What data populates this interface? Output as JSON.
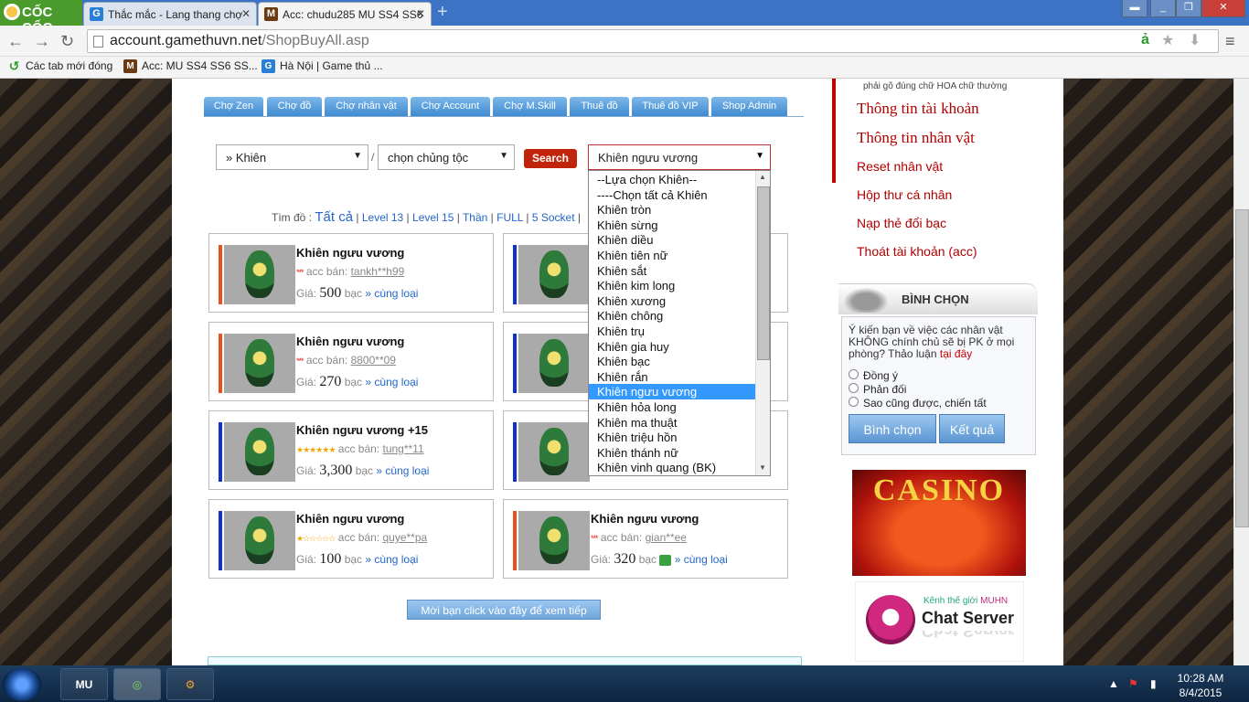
{
  "browser": {
    "brand": "CỐC CỐC",
    "tabs": [
      {
        "title": "Thắc mắc - Lang thang chợ",
        "icon": "G"
      },
      {
        "title": "Acc: chudu285 MU SS4 SS6",
        "icon": "M"
      }
    ],
    "url_host": "account.gamethuvn.net",
    "url_path": "/ShopBuyAll.asp",
    "bookmarks": [
      "Các tab mới đóng",
      "Acc: MU SS4 SS6 SS...",
      "Hà Nội | Game thủ ..."
    ]
  },
  "nav_tabs": [
    "Chợ Zen",
    "Chợ đồ",
    "Chợ nhân vật",
    "Chợ Account",
    "Chợ M.Skill",
    "Thuê đồ",
    "Thuê đồ VIP",
    "Shop Admin"
  ],
  "search": {
    "category": "» Khiên",
    "separator": "/",
    "race": "chọn chủng tộc",
    "button": "Search",
    "item_select": "Khiên ngưu vương"
  },
  "filter": {
    "label": "Tìm đồ :",
    "all": "Tất cả",
    "options": [
      "Level 13",
      "Level 15",
      "Thần",
      "FULL",
      "5 Socket"
    ]
  },
  "dropdown_options": [
    "--Lựa chọn Khiên--",
    "----Chọn tất cả Khiên",
    "Khiên tròn",
    "Khiên sừng",
    "Khiên diều",
    "Khiên tiên nữ",
    "Khiên sắt",
    "Khiên kim long",
    "Khiên xương",
    "Khiên chông",
    "Khiên trụ",
    "Khiên gia huy",
    "Khiên bạc",
    "Khiên rắn",
    "Khiên ngưu vương",
    "Khiên hỏa long",
    "Khiên ma thuật",
    "Khiên triệu hồn",
    "Khiên thánh nữ",
    "Khiên vinh quang (BK)"
  ],
  "dropdown_selected_index": 14,
  "cards": [
    {
      "name": "Khiên ngưu vương",
      "seller_label": "acc bán:",
      "seller": "tankh**h99",
      "price_label": "Giá:",
      "price": "500",
      "unit": "bạc",
      "same": "» cùng loại",
      "rating": "***",
      "bar": "#e8501e"
    },
    {
      "name": "Khiên ngưu vương",
      "seller_label": "acc bán:",
      "seller": "8800**09",
      "price_label": "Giá:",
      "price": "270",
      "unit": "bạc",
      "same": "» cùng loại",
      "rating": "***",
      "bar": "#e8501e"
    },
    {
      "name": "Khiên ngưu vương +15",
      "seller_label": "acc bán:",
      "seller": "tung**11",
      "price_label": "Giá:",
      "price": "3,300",
      "unit": "bạc",
      "same": "» cùng loại",
      "rating": "★★★★★★",
      "bar": "#1030d0"
    },
    {
      "name": "Khiên ngưu vương",
      "seller_label": "acc bán:",
      "seller": "quye**pa",
      "price_label": "Giá:",
      "price": "100",
      "unit": "bạc",
      "same": "» cùng loại",
      "rating": "★☆☆☆☆☆",
      "bar": "#1030d0"
    },
    {
      "name": "Khiên ngưu vương",
      "seller_label": "acc bán:",
      "seller": "gian**ee",
      "price_label": "Giá:",
      "price": "320",
      "unit": "bạc",
      "same": "» cùng loại",
      "rating": "***",
      "bar": "#e8501e"
    }
  ],
  "more_button": "Mời bạn click vào đây để xem tiếp",
  "sidebar": {
    "hint": "phải gõ đúng chữ HOA chữ thường",
    "links": [
      "Thông tin tài khoản",
      "Thông tin nhân vật",
      "Reset nhân vật",
      "Hộp thư cá nhân",
      "Nạp thẻ đổi bạc",
      "Thoát tài khoản (acc)"
    ],
    "poll": {
      "title": "BÌNH CHỌN",
      "question": "Ý kiến bạn về việc các nhân vật KHÔNG chính chủ sẽ bị PK ở mọi phòng? Thảo luận",
      "question_link": "tại đây",
      "options": [
        "Đồng ý",
        "Phản đối",
        "Sao cũng được, chiến tất"
      ],
      "vote_button": "Bình chọn",
      "result_button": "Kết quả"
    },
    "casino": "CASINO",
    "chat_kenh": "Kênh thế giới",
    "chat_brand": "MUHN",
    "chat_title": "Chat Server"
  },
  "taskbar": {
    "time": "10:28 AM",
    "date": "8/4/2015"
  }
}
